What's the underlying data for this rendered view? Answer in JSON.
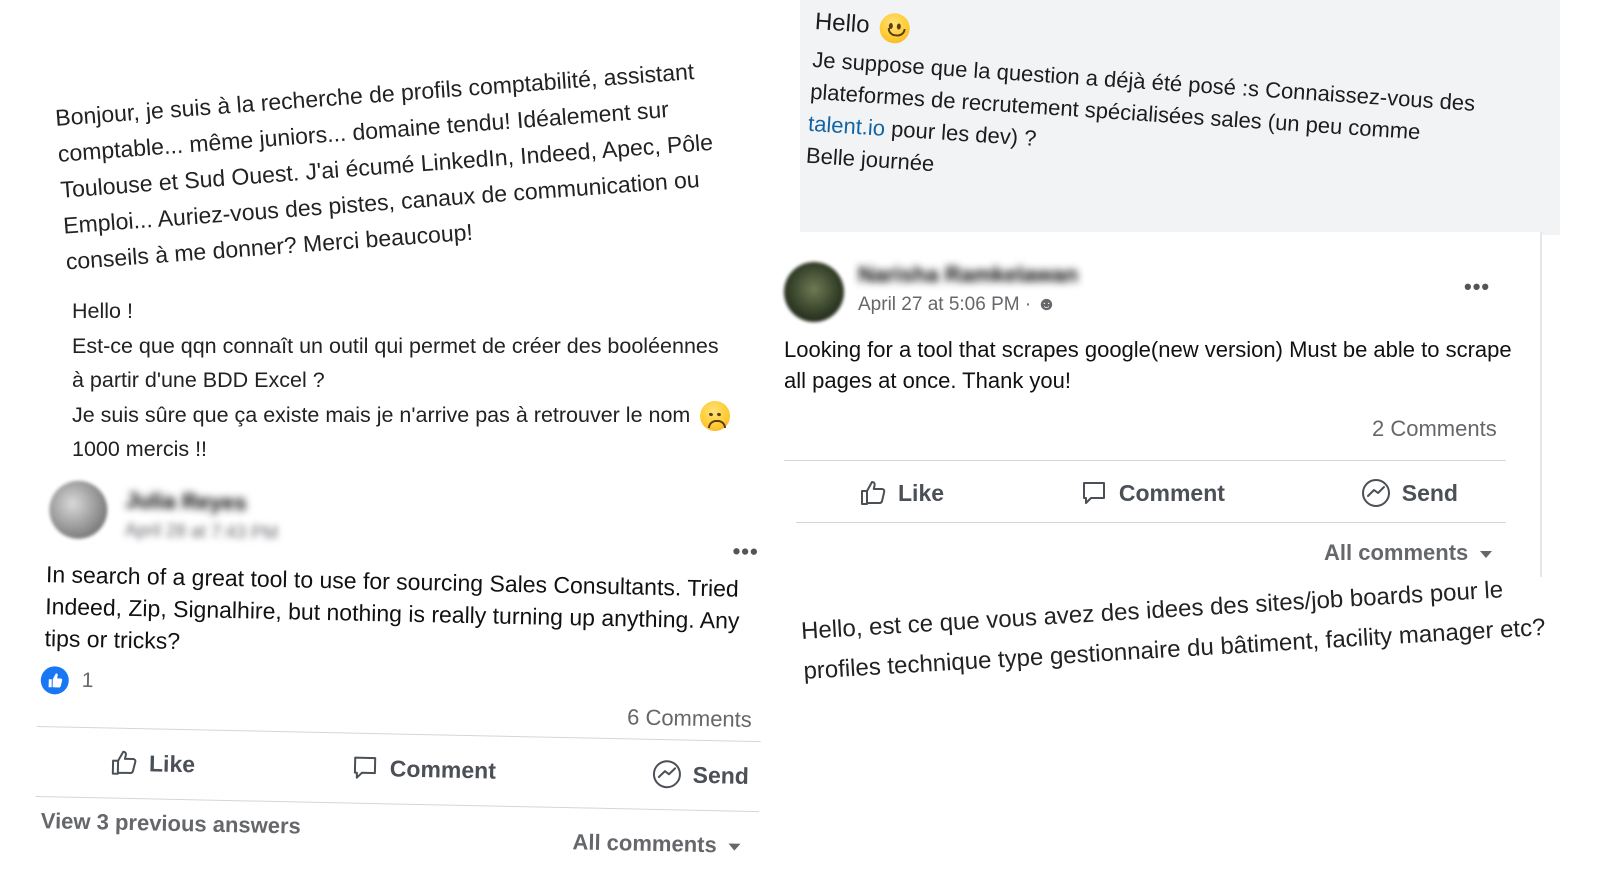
{
  "snippet1": {
    "text": "Bonjour, je suis à la recherche de profils comptabilité, assistant comptable... même juniors... domaine tendu! Idéalement sur Toulouse et Sud Ouest. J'ai écumé LinkedIn, Indeed, Apec, Pôle Emploi... Auriez-vous des pistes, canaux de communication ou conseils à me donner? Merci beaucoup!"
  },
  "snippet2": {
    "line1": "Hello !",
    "line2": "Est-ce que qqn connaît un outil qui permet de créer des booléennes",
    "line3": "à partir d'une BDD Excel ?",
    "line4": "Je suis sûre que ça existe mais je n'arrive pas à retrouver le nom",
    "line5": "1000 mercis !!",
    "emoji": "disappointed-face-icon"
  },
  "post1": {
    "author": "Julia Reyes",
    "meta": "April 28 at 7:43 PM",
    "more": "•••",
    "text": "In search of a great tool to use for sourcing Sales Consultants. Tried Indeed, Zip, Signalhire, but nothing is really turning up anything. Any tips or tricks?",
    "reactions": "1",
    "comments": "6 Comments",
    "like": "Like",
    "comment": "Comment",
    "send": "Send",
    "view_previous": "View 3 previous answers",
    "all_comments": "All comments"
  },
  "snippet3": {
    "greeting": "Hello",
    "emoji": "slightly-smiling-face-icon",
    "line1": "Je suppose que la question a déjà été posé :s Connaissez-vous des",
    "line2": "plateformes de recrutement spécialisées sales (un peu comme",
    "link": "talent.io",
    "line3_rest": " pour les dev) ?",
    "line4": "Belle journée"
  },
  "post2": {
    "author": "Narisha Ramkelawan",
    "meta": "April 27 at 5:06 PM · ",
    "more": "•••",
    "text": "Looking for a tool that scrapes google(new version) Must be able to scrape all pages at once. Thank you!",
    "comments": "2 Comments",
    "like": "Like",
    "comment": "Comment",
    "send": "Send",
    "all_comments": "All comments"
  },
  "snippet4": {
    "text": "Hello, est ce que vous avez des idees des sites/job boards pour le profiles technique type gestionnaire du bâtiment, facility manager etc?"
  },
  "colors": {
    "facebook_blue": "#1877f2",
    "link_blue": "#1264a3",
    "muted": "#65676b"
  }
}
